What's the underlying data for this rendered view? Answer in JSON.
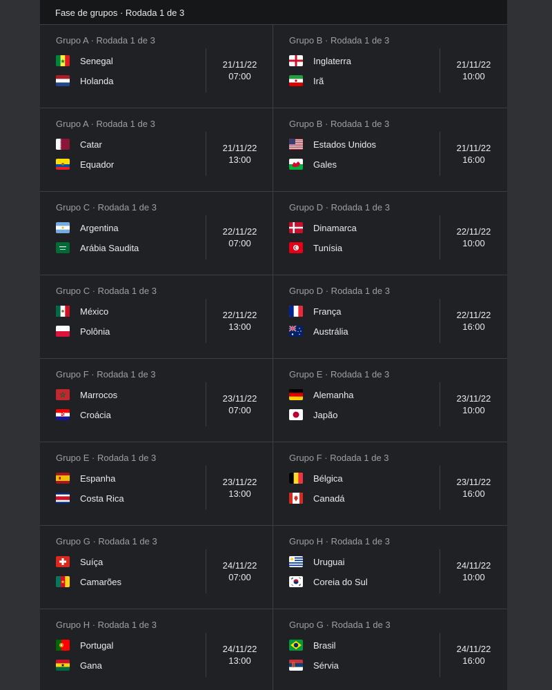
{
  "header": {
    "title": "Fase de grupos · Rodada 1 de 3"
  },
  "matches": [
    {
      "group": "Grupo A · Rodada 1 de 3",
      "team1": {
        "name": "Senegal",
        "flag": "senegal-flag"
      },
      "team2": {
        "name": "Holanda",
        "flag": "netherlands-flag"
      },
      "date": "21/11/22",
      "time": "07:00"
    },
    {
      "group": "Grupo B · Rodada 1 de 3",
      "team1": {
        "name": "Inglaterra",
        "flag": "england-flag"
      },
      "team2": {
        "name": "Irã",
        "flag": "iran-flag"
      },
      "date": "21/11/22",
      "time": "10:00"
    },
    {
      "group": "Grupo A · Rodada 1 de 3",
      "team1": {
        "name": "Catar",
        "flag": "qatar-flag"
      },
      "team2": {
        "name": "Equador",
        "flag": "ecuador-flag"
      },
      "date": "21/11/22",
      "time": "13:00"
    },
    {
      "group": "Grupo B · Rodada 1 de 3",
      "team1": {
        "name": "Estados Unidos",
        "flag": "usa-flag"
      },
      "team2": {
        "name": "Gales",
        "flag": "wales-flag"
      },
      "date": "21/11/22",
      "time": "16:00"
    },
    {
      "group": "Grupo C · Rodada 1 de 3",
      "team1": {
        "name": "Argentina",
        "flag": "argentina-flag"
      },
      "team2": {
        "name": "Arábia Saudita",
        "flag": "saudi-arabia-flag"
      },
      "date": "22/11/22",
      "time": "07:00"
    },
    {
      "group": "Grupo D · Rodada 1 de 3",
      "team1": {
        "name": "Dinamarca",
        "flag": "denmark-flag"
      },
      "team2": {
        "name": "Tunísia",
        "flag": "tunisia-flag"
      },
      "date": "22/11/22",
      "time": "10:00"
    },
    {
      "group": "Grupo C · Rodada 1 de 3",
      "team1": {
        "name": "México",
        "flag": "mexico-flag"
      },
      "team2": {
        "name": "Polônia",
        "flag": "poland-flag"
      },
      "date": "22/11/22",
      "time": "13:00"
    },
    {
      "group": "Grupo D · Rodada 1 de 3",
      "team1": {
        "name": "França",
        "flag": "france-flag"
      },
      "team2": {
        "name": "Austrália",
        "flag": "australia-flag"
      },
      "date": "22/11/22",
      "time": "16:00"
    },
    {
      "group": "Grupo F · Rodada 1 de 3",
      "team1": {
        "name": "Marrocos",
        "flag": "morocco-flag"
      },
      "team2": {
        "name": "Croácia",
        "flag": "croatia-flag"
      },
      "date": "23/11/22",
      "time": "07:00"
    },
    {
      "group": "Grupo E · Rodada 1 de 3",
      "team1": {
        "name": "Alemanha",
        "flag": "germany-flag"
      },
      "team2": {
        "name": "Japão",
        "flag": "japan-flag"
      },
      "date": "23/11/22",
      "time": "10:00"
    },
    {
      "group": "Grupo E · Rodada 1 de 3",
      "team1": {
        "name": "Espanha",
        "flag": "spain-flag"
      },
      "team2": {
        "name": "Costa Rica",
        "flag": "costa-rica-flag"
      },
      "date": "23/11/22",
      "time": "13:00"
    },
    {
      "group": "Grupo F · Rodada 1 de 3",
      "team1": {
        "name": "Bélgica",
        "flag": "belgium-flag"
      },
      "team2": {
        "name": "Canadá",
        "flag": "canada-flag"
      },
      "date": "23/11/22",
      "time": "16:00"
    },
    {
      "group": "Grupo G · Rodada 1 de 3",
      "team1": {
        "name": "Suíça",
        "flag": "switzerland-flag"
      },
      "team2": {
        "name": "Camarões",
        "flag": "cameroon-flag"
      },
      "date": "24/11/22",
      "time": "07:00"
    },
    {
      "group": "Grupo H · Rodada 1 de 3",
      "team1": {
        "name": "Uruguai",
        "flag": "uruguay-flag"
      },
      "team2": {
        "name": "Coreia do Sul",
        "flag": "south-korea-flag"
      },
      "date": "24/11/22",
      "time": "10:00"
    },
    {
      "group": "Grupo H · Rodada 1 de 3",
      "team1": {
        "name": "Portugal",
        "flag": "portugal-flag"
      },
      "team2": {
        "name": "Gana",
        "flag": "ghana-flag"
      },
      "date": "24/11/22",
      "time": "13:00"
    },
    {
      "group": "Grupo G · Rodada 1 de 3",
      "team1": {
        "name": "Brasil",
        "flag": "brazil-flag"
      },
      "team2": {
        "name": "Sérvia",
        "flag": "serbia-flag"
      },
      "date": "24/11/22",
      "time": "16:00"
    }
  ]
}
